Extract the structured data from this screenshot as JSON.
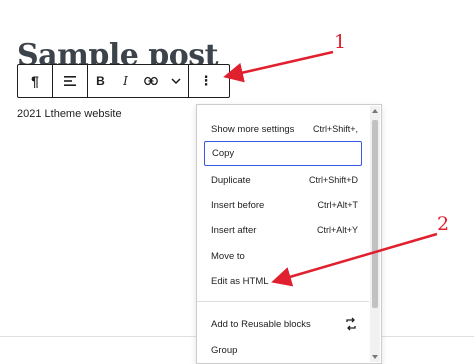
{
  "post": {
    "title": "Sample post",
    "paragraph": "2021 Ltheme website"
  },
  "toolbar": {
    "buttons": [
      {
        "name": "paragraph-icon",
        "glyph": "¶"
      },
      {
        "name": "align-left-icon"
      },
      {
        "name": "bold-icon",
        "glyph": "B"
      },
      {
        "name": "italic-icon",
        "glyph": "I"
      },
      {
        "name": "link-icon"
      },
      {
        "name": "chevron-down-icon"
      },
      {
        "name": "more-options-icon",
        "glyph": "⋮"
      }
    ]
  },
  "menu": {
    "items": [
      {
        "label": "Show more settings",
        "shortcut": "Ctrl+Shift+,"
      },
      {
        "label": "Copy",
        "shortcut": ""
      },
      {
        "label": "Duplicate",
        "shortcut": "Ctrl+Shift+D"
      },
      {
        "label": "Insert before",
        "shortcut": "Ctrl+Alt+T"
      },
      {
        "label": "Insert after",
        "shortcut": "Ctrl+Alt+Y"
      },
      {
        "label": "Move to",
        "shortcut": ""
      },
      {
        "label": "Edit as HTML",
        "shortcut": ""
      },
      {
        "label": "Add to Reusable blocks",
        "shortcut": ""
      },
      {
        "label": "Group",
        "shortcut": ""
      }
    ],
    "reusable_icon": "reusable-blocks-icon"
  },
  "annotations": {
    "label_1": "1",
    "label_2": "2",
    "color": "#e0202e"
  },
  "colors": {
    "focus": "#3858e9",
    "text": "#1e1e1e",
    "title": "#3c434a"
  }
}
